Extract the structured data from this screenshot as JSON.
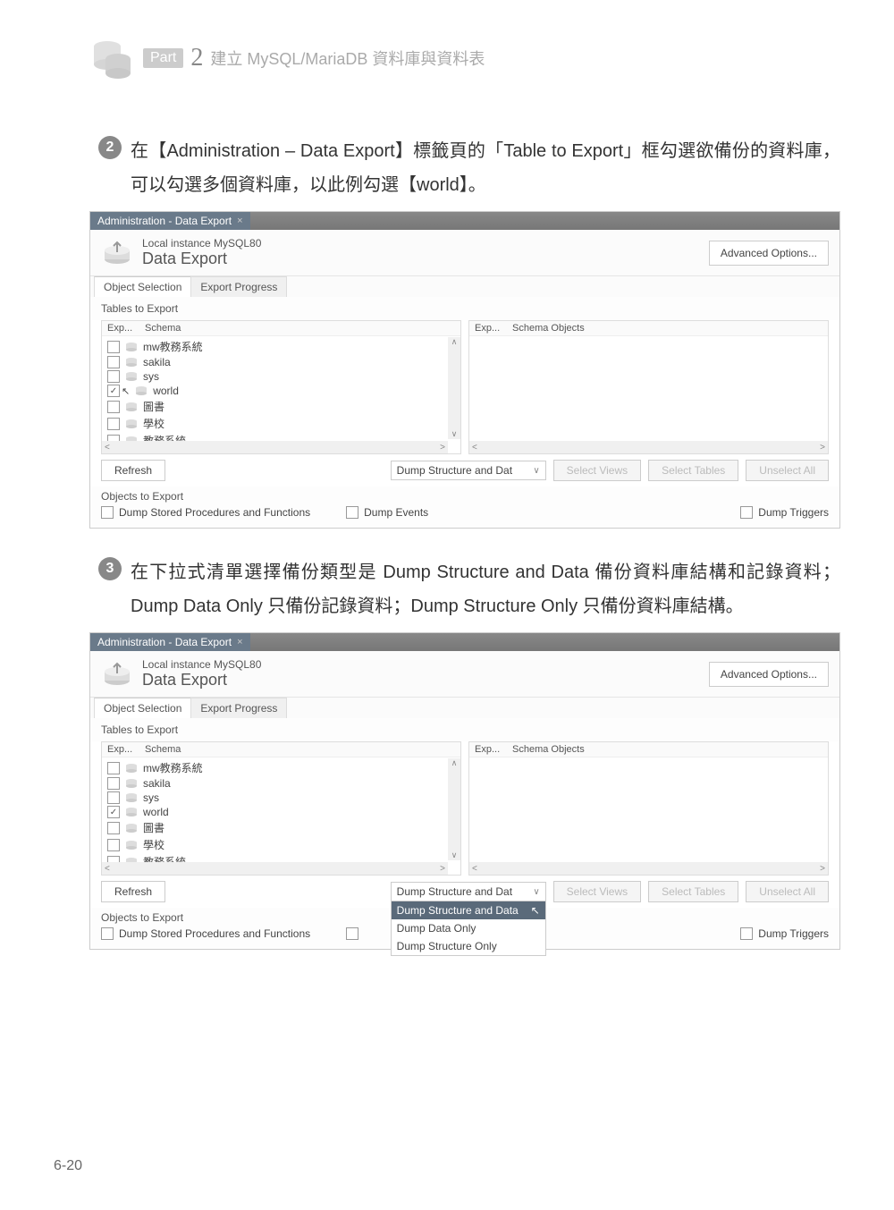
{
  "header": {
    "part_label": "Part",
    "part_number": "2",
    "part_title": "建立 MySQL/MariaDB 資料庫與資料表"
  },
  "step2": {
    "badge": "2",
    "text": "在【Administration – Data Export】標籤頁的「Table to Export」框勾選欲備份的資料庫，可以勾選多個資料庫，以此例勾選【world】。"
  },
  "step3": {
    "badge": "3",
    "text": "在下拉式清單選擇備份類型是 Dump Structure and Data 備份資料庫結構和記錄資料；Dump Data Only 只備份記錄資料；Dump Structure Only 只備份資料庫結構。"
  },
  "shot": {
    "tab_title": "Administration - Data Export",
    "instance": "Local instance MySQL80",
    "title": "Data Export",
    "advanced": "Advanced Options...",
    "subtab1": "Object Selection",
    "subtab2": "Export Progress",
    "tables_label": "Tables to Export",
    "col_exp": "Exp...",
    "col_schema": "Schema",
    "col_right_exp": "Exp...",
    "col_right_obj": "Schema Objects",
    "schemas": [
      {
        "name": "mw教務系統",
        "checked": false
      },
      {
        "name": "sakila",
        "checked": false
      },
      {
        "name": "sys",
        "checked": false
      },
      {
        "name": "world",
        "checked": true
      },
      {
        "name": "圖書",
        "checked": false
      },
      {
        "name": "學校",
        "checked": false
      },
      {
        "name": "教務系統",
        "checked": false
      }
    ],
    "refresh": "Refresh",
    "dump_dd": "Dump Structure and Dat",
    "sel_views": "Select Views",
    "sel_tables": "Select Tables",
    "unsel_all": "Unselect All",
    "objects_label": "Objects to Export",
    "dump_sp": "Dump Stored Procedures and Functions",
    "dump_events": "Dump Events",
    "dump_triggers": "Dump Triggers",
    "dd_options": [
      "Dump Structure and Data",
      "Dump Data Only",
      "Dump Structure Only"
    ]
  },
  "page_number": "6-20"
}
